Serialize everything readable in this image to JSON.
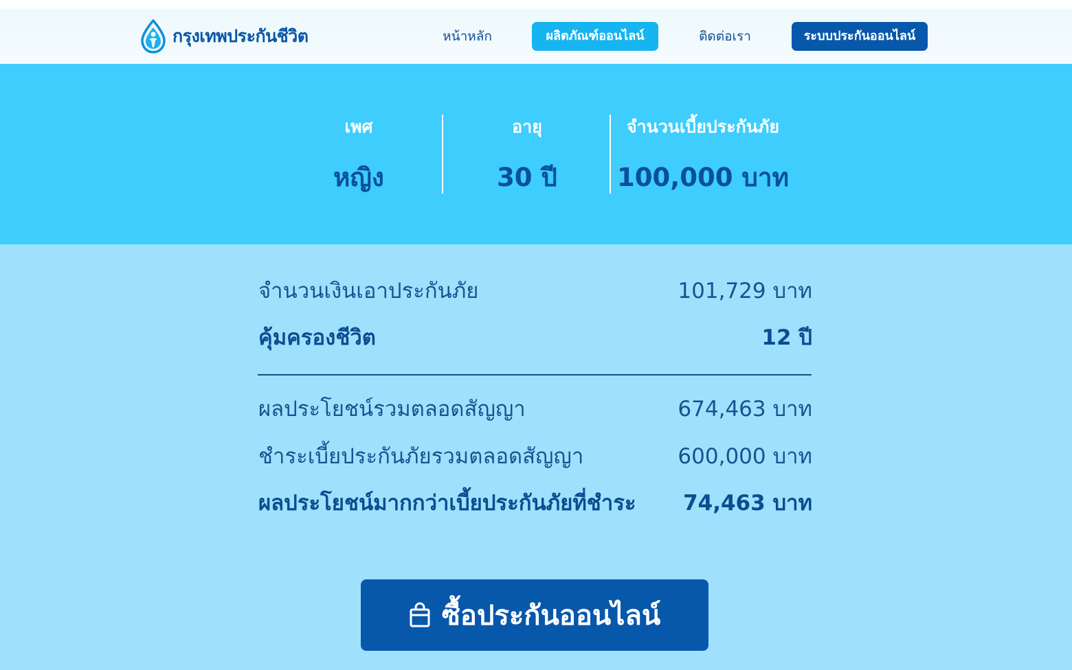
{
  "header": {
    "logo_text": "กรุงเทพประกันชีวิต",
    "nav": {
      "home": "หน้าหลัก",
      "products_online": "ผลิตภัณฑ์ออนไลน์",
      "contact": "ติดต่อเรา",
      "online_system": "ระบบประกันออนไลน์"
    }
  },
  "summary": {
    "gender_label": "เพศ",
    "gender_value": "หญิง",
    "age_label": "อายุ",
    "age_value": "30 ปี",
    "premium_label": "จำนวนเบี้ยประกันภัย",
    "premium_value": "100,000 บาท"
  },
  "details": {
    "sum_assured_label": "จำนวนเงินเอาประกันภัย",
    "sum_assured_value": "101,729 บาท",
    "coverage_label": "คุ้มครองชีวิต",
    "coverage_value": "12 ปี",
    "total_benefit_label": "ผลประโยชน์รวมตลอดสัญญา",
    "total_benefit_value": "674,463 บาท",
    "total_premium_label": "ชำระเบี้ยประกันภัยรวมตลอดสัญญา",
    "total_premium_value": "600,000 บาท",
    "excess_benefit_label": "ผลประโยชน์มากกว่าเบี้ยประกันภัยที่ชำระ",
    "excess_benefit_value": "74,463 บาท"
  },
  "buy_button": {
    "label": "ซื้อประกันออนไลน์",
    "icon": "shopping-bag-icon"
  },
  "colors": {
    "brand_dark": "#0758ab",
    "brand_cyan": "#16b4f0",
    "band": "#3ecdfd",
    "page_bg": "#9fe1fd"
  }
}
